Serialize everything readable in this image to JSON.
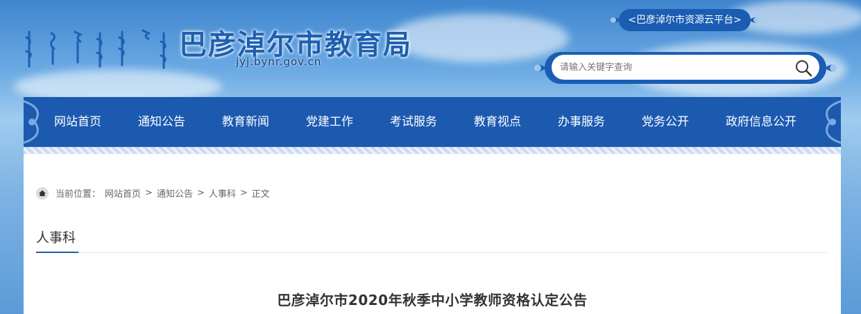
{
  "header": {
    "site_title": "巴彦淖尔市教育局",
    "domain": "jyj.bynr.gov.cn",
    "resource_link": "<巴彦淖尔市资源云平台>",
    "search_placeholder": "请输入关键字查询"
  },
  "nav": {
    "items": [
      "网站首页",
      "通知公告",
      "教育新闻",
      "党建工作",
      "考试服务",
      "教育视点",
      "办事服务",
      "党务公开",
      "政府信息公开"
    ]
  },
  "breadcrumb": {
    "label": "当前位置：",
    "items": [
      "网站首页",
      "通知公告",
      "人事科",
      "正文"
    ],
    "separator": ">"
  },
  "section": {
    "title": "人事科"
  },
  "article": {
    "title": "巴彦淖尔市2020年秋季中小学教师资格认定公告"
  },
  "colors": {
    "nav_bg": "#1c5ab0",
    "accent": "#1a5db3"
  }
}
